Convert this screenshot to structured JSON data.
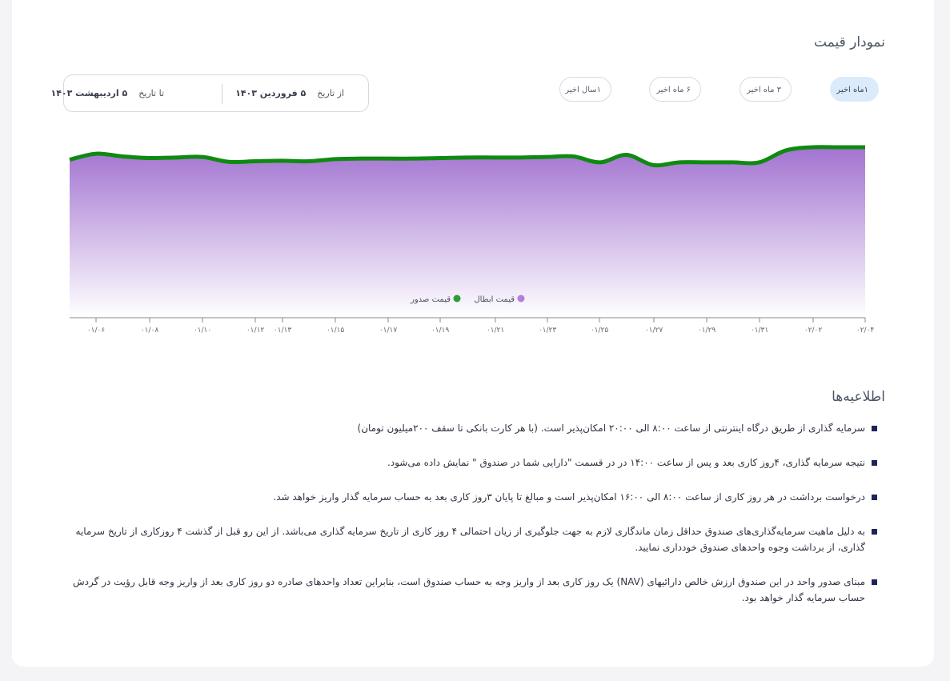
{
  "price_chart": {
    "title": "نمودار قیمت",
    "period_tabs": [
      {
        "label": "۱ماه اخیر",
        "active": true
      },
      {
        "label": "۳ ماه اخیر",
        "active": false
      },
      {
        "label": "۶ ماه اخیر",
        "active": false
      },
      {
        "label": "۱سال اخیر",
        "active": false
      }
    ],
    "date_range": {
      "from_label": "از تاریخ",
      "from_value": "۵ فروردین ۱۴۰۳",
      "to_label": "تا تاریخ",
      "to_value": "۵ اردیبهشت ۱۴۰۳"
    }
  },
  "chart_data": {
    "type": "area",
    "x": [
      "۰۱/۰۵",
      "۰۱/۰۶",
      "۰۱/۰۷",
      "۰۱/۰۸",
      "۰۱/۰۹",
      "۰۱/۱۰",
      "۰۱/۱۱",
      "۰۱/۱۲",
      "۰۱/۱۳",
      "۰۱/۱۴",
      "۰۱/۱۵",
      "۰۱/۱۶",
      "۰۱/۱۷",
      "۰۱/۱۸",
      "۰۱/۱۹",
      "۰۱/۲۰",
      "۰۱/۲۱",
      "۰۱/۲۲",
      "۰۱/۲۳",
      "۰۱/۲۴",
      "۰۱/۲۵",
      "۰۱/۲۶",
      "۰۱/۲۷",
      "۰۱/۲۸",
      "۰۱/۲۹",
      "۰۱/۳۰",
      "۰۱/۳۱",
      "۰۲/۰۱",
      "۰۲/۰۲",
      "۰۲/۰۳",
      "۰۲/۰۴"
    ],
    "x_ticks": [
      "۰۱/۰۶",
      "۰۱/۰۸",
      "۰۱/۱۰",
      "۰۱/۱۲",
      "۰۱/۱۳",
      "۰۱/۱۵",
      "۰۱/۱۷",
      "۰۱/۱۹",
      "۰۱/۲۱",
      "۰۱/۲۳",
      "۰۱/۲۵",
      "۰۱/۲۷",
      "۰۱/۲۹",
      "۰۱/۳۱",
      "۰۲/۰۲",
      "۰۲/۰۴"
    ],
    "series": [
      {
        "name": "قیمت صدور",
        "color": "#2e9b34",
        "values": [
          96.3,
          97.4,
          96.9,
          96.6,
          96.7,
          96.8,
          95.9,
          96.0,
          96.1,
          96.0,
          96.4,
          96.5,
          96.5,
          96.5,
          96.6,
          96.7,
          96.7,
          96.7,
          96.8,
          96.9,
          95.8,
          97.2,
          95.3,
          95.8,
          95.8,
          95.8,
          95.8,
          98.0,
          98.6,
          98.6,
          98.6
        ]
      },
      {
        "name": "قیمت ابطال",
        "color": "#b57fd8",
        "values": [
          96.0,
          97.1,
          96.6,
          96.3,
          96.4,
          96.5,
          95.6,
          95.7,
          95.8,
          95.7,
          96.1,
          96.2,
          96.2,
          96.2,
          96.3,
          96.4,
          96.4,
          96.4,
          96.5,
          96.6,
          95.5,
          96.9,
          95.0,
          95.5,
          95.5,
          95.5,
          95.5,
          97.7,
          98.3,
          98.3,
          98.3
        ]
      }
    ],
    "legend": [
      {
        "name": "قیمت ابطال",
        "color": "#b57fd8"
      },
      {
        "name": "قیمت صدور",
        "color": "#2e9b34"
      }
    ],
    "ylim": [
      0,
      100
    ],
    "grid": false,
    "legend_position": "bottom-center",
    "colors": {
      "line": "#0f8a10",
      "fill_top": "#a374d1",
      "fill_bottom": "#ffffff"
    }
  },
  "notices": {
    "title": "اطلاعیه‌ها",
    "items": [
      "سرمایه گذاری از طریق درگاه اینترنتی از ساعت ۸:۰۰ الی ۲۰:۰۰ امکان‌پذیر است. (با هر کارت بانکی تا سقف ۲۰۰میلیون تومان)",
      "نتیجه سرمایه گذاری، ۴روز کاری بعد و پس از ساعت ۱۴:۰۰ در در قسمت \"دارایی شما در صندوق \" نمایش داده می‌شود.",
      "درخواست برداشت در هر روز کاری از ساعت ۸:۰۰ الی ۱۶:۰۰ امکان‌پذیر است و مبالغ تا پایان ۳روز کاری بعد به حساب سرمایه گذار واریز خواهد شد.",
      "به دلیل ماهیت سرمایه‌گذاری‌های صندوق حداقل زمان ماندگاری لازم به جهت جلوگیری از زیان احتمالی ۴ روز کاری از تاریخ سرمایه گذاری می‌باشد. از این رو قبل از گذشت ۴ روزکاری از تاریخ سرمایه گذاری، از برداشت وجوه واحدهای صندوق خودداری نمایید.",
      "مبنای صدور واحد در این صندوق ارزش خالص دارائیهای (NAV) یک روز کاری بعد از واریز وجه به حساب صندوق است، بنابراین تعداد واحدهای صادره دو روز کاری بعد از واریز وجه قابل رؤیت در گردش حساب سرمایه گذار خواهد بود."
    ]
  }
}
